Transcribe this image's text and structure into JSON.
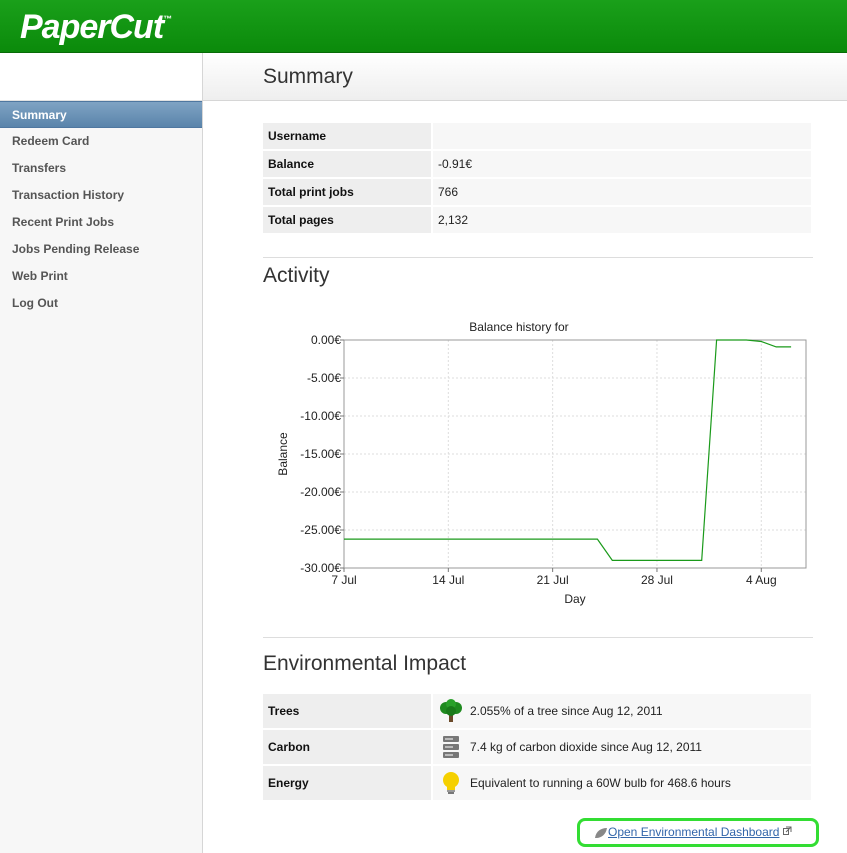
{
  "header": {
    "logo": "PaperCut",
    "logo_tm": "™"
  },
  "sidebar": {
    "items": [
      {
        "label": "Summary",
        "active": true
      },
      {
        "label": "Redeem Card",
        "active": false
      },
      {
        "label": "Transfers",
        "active": false
      },
      {
        "label": "Transaction History",
        "active": false
      },
      {
        "label": "Recent Print Jobs",
        "active": false
      },
      {
        "label": "Jobs Pending Release",
        "active": false
      },
      {
        "label": "Web Print",
        "active": false
      },
      {
        "label": "Log Out",
        "active": false
      }
    ]
  },
  "page": {
    "title": "Summary"
  },
  "summary": {
    "rows": [
      {
        "label": "Username",
        "value": ""
      },
      {
        "label": "Balance",
        "value": "-0.91€"
      },
      {
        "label": "Total print jobs",
        "value": "766"
      },
      {
        "label": "Total pages",
        "value": "2,132"
      }
    ]
  },
  "activity": {
    "title": "Activity"
  },
  "chart_data": {
    "type": "line",
    "title": "Balance history for",
    "xlabel": "Day",
    "ylabel": "Balance",
    "x_ticks": [
      "7 Jul",
      "14 Jul",
      "21 Jul",
      "28 Jul",
      "4 Aug"
    ],
    "y_ticks": [
      "0.00€",
      "-5.00€",
      "-10.00€",
      "-15.00€",
      "-20.00€",
      "-25.00€",
      "-30.00€"
    ],
    "xlim": [
      "2011-07-07",
      "2011-08-07"
    ],
    "ylim": [
      -30,
      0
    ],
    "grid": true,
    "series": [
      {
        "color": "#1a9a1a",
        "points": [
          {
            "x": "2011-07-07",
            "y": -26.2
          },
          {
            "x": "2011-07-24",
            "y": -26.2
          },
          {
            "x": "2011-07-25",
            "y": -29.0
          },
          {
            "x": "2011-07-31",
            "y": -29.0
          },
          {
            "x": "2011-08-01",
            "y": 0.0
          },
          {
            "x": "2011-08-03",
            "y": 0.0
          },
          {
            "x": "2011-08-04",
            "y": -0.2
          },
          {
            "x": "2011-08-05",
            "y": -0.91
          },
          {
            "x": "2011-08-06",
            "y": -0.91
          }
        ]
      }
    ]
  },
  "environment": {
    "title": "Environmental Impact",
    "rows": [
      {
        "label": "Trees",
        "icon": "tree-icon",
        "value": "2.055% of a tree since Aug 12, 2011"
      },
      {
        "label": "Carbon",
        "icon": "server-stack-icon",
        "value": "7.4 kg of carbon dioxide since Aug 12, 2011"
      },
      {
        "label": "Energy",
        "icon": "lightbulb-icon",
        "value": "Equivalent to running a 60W bulb for 468.6 hours"
      }
    ],
    "dashboard_link": "Open Environmental Dashboard"
  },
  "colors": {
    "header_green": "#0f920f",
    "active_nav": "#6b92b8",
    "link": "#3366aa",
    "highlight": "#33dd33"
  }
}
